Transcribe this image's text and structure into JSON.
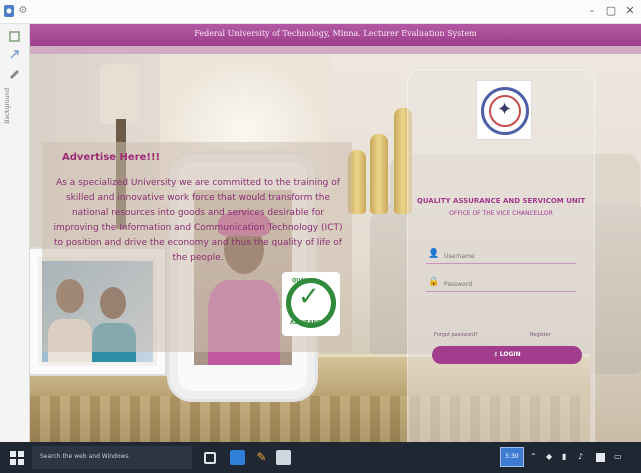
{
  "window": {
    "controls": {
      "minimize": "-",
      "restore": "▢",
      "close": "✕"
    },
    "side_toolbar_label": "Background"
  },
  "header": {
    "title": "Federal University of Technology, Minna. Lecturer Evaluation System"
  },
  "advert": {
    "title": "Advertise Here!!!",
    "body": "As a specialized University we are committed to the training of skilled and innovative work force that would transform the national resources into goods and services desirable for improving the Information and Communication Technology (ICT) to position and drive the economy and thus the quality of life of the people."
  },
  "badge": {
    "text_top": "QUALITY",
    "text_bottom": "ASSURANCE"
  },
  "login": {
    "unit_title": "QUALITY ASSURANCE AND SERVICOM UNIT",
    "unit_subtitle": "OFFICE OF THE VICE CHANCELLOR",
    "username_placeholder": "Username",
    "password_placeholder": "Password",
    "forgot_password": "Forgot password?",
    "register": "Register",
    "login_button": "LOGIN",
    "accent_color": "#a23d8e"
  },
  "taskbar": {
    "search_placeholder": "Search the web and Windows",
    "clock": "5:30"
  }
}
